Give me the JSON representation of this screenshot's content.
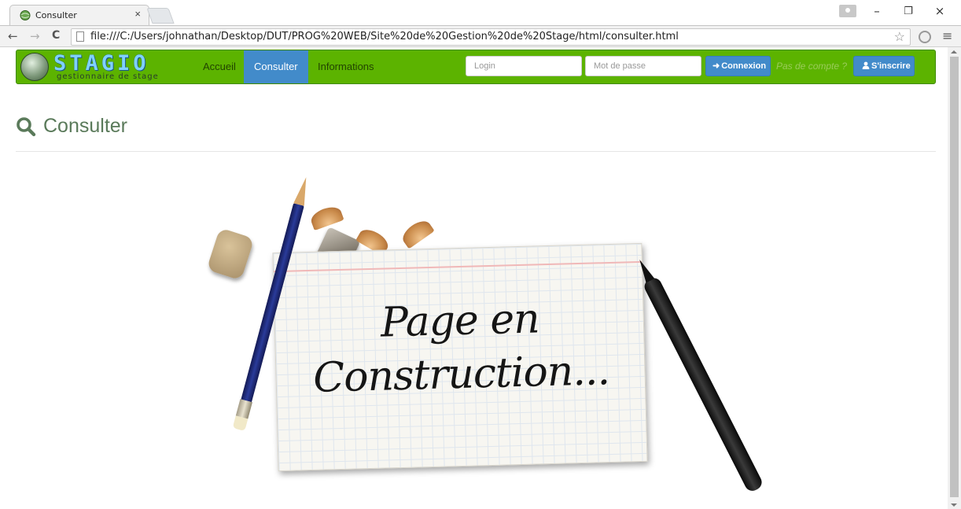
{
  "browser": {
    "tab_title": "Consulter",
    "tab_close": "×",
    "url": "file:///C:/Users/johnathan/Desktop/DUT/PROG%20WEB/Site%20de%20Gestion%20de%20Stage/html/consulter.html",
    "icons": {
      "back": "←",
      "forward": "→",
      "reload": "C",
      "star": "☆",
      "menu": "≡",
      "minimize": "–",
      "restore": "❐",
      "close": "×"
    }
  },
  "site": {
    "brand": {
      "name": "STAGIO",
      "tagline": "gestionnaire de stage"
    },
    "nav": [
      {
        "label": "Accueil",
        "active": false
      },
      {
        "label": "Consulter",
        "active": true
      },
      {
        "label": "Informations",
        "active": false
      }
    ],
    "login": {
      "login_placeholder": "Login",
      "password_placeholder": "Mot de passe",
      "connect_label": "Connexion",
      "no_account_text": "Pas de compte ?",
      "signup_label": "S'inscrire"
    },
    "colors": {
      "navbar": "#5cb300",
      "active_nav": "#428bca",
      "button": "#428bca",
      "heading": "#5a7a5a"
    }
  },
  "page": {
    "heading": "Consulter",
    "heading_icon": "search-icon",
    "construction": {
      "line1": "Page en",
      "line2": "Construction..."
    }
  }
}
